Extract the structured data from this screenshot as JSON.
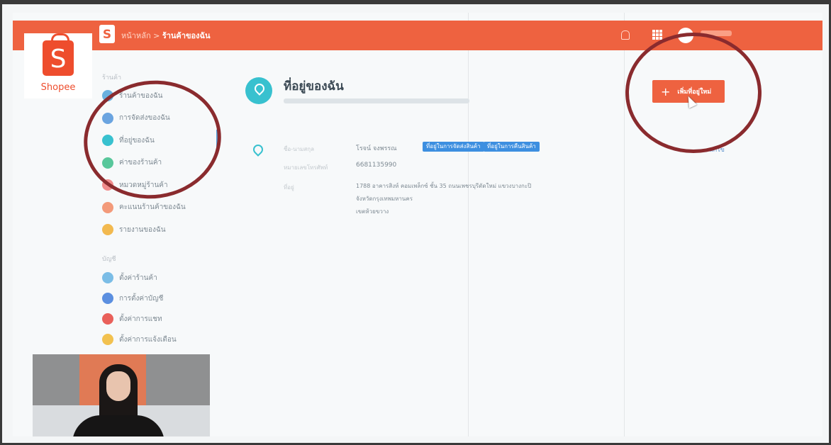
{
  "header": {
    "crumb_home": "หน้าหลัก > ",
    "crumb_current": "ร้านค้าของฉัน",
    "logo_letter": "S"
  },
  "logo": {
    "letter": "S",
    "word": "Shopee"
  },
  "sidebar": {
    "group1_label": "ร้านค้า",
    "items": [
      {
        "label": "ร้านค้าของฉัน",
        "color": "#6ab0de"
      },
      {
        "label": "การจัดส่งของฉัน",
        "color": "#6aa4e0"
      },
      {
        "label": "ที่อยู่ของฉัน",
        "color": "#38c1cf"
      },
      {
        "label": "ค่าของร้านค้า",
        "color": "#58c79b"
      },
      {
        "label": "หมวดหมู่ร้านค้า",
        "color": "#f08c8c"
      },
      {
        "label": "คะแนนร้านค้าของฉัน",
        "color": "#f39a7a"
      },
      {
        "label": "รายงานของฉัน",
        "color": "#f2b94f"
      }
    ],
    "group2_label": "บัญชี",
    "items2": [
      {
        "label": "ตั้งค่าร้านค้า",
        "color": "#7bbde6"
      },
      {
        "label": "การตั้งค่าบัญชี",
        "color": "#5b8fe0"
      },
      {
        "label": "ตั้งค่าการแชท",
        "color": "#e9605a"
      },
      {
        "label": "ตั้งค่าการแจ้งเตือน",
        "color": "#f2c14f"
      }
    ]
  },
  "main": {
    "title": "ที่อยู่ของฉัน",
    "add_button": "เพิ่มที่อยู่ใหม่",
    "edit_link": "แก้ไข",
    "address": {
      "name_label": "ชื่อ-นามสกุล",
      "name_value": "โรจน์ จงพรรณ",
      "tags": [
        "ที่อยู่ในการจัดส่งสินค้า",
        "ที่อยู่ในการคืนสินค้า"
      ],
      "phone_label": "หมายเลขโทรศัพท์",
      "phone_value": "6681135990",
      "addr_label": "ที่อยู่",
      "addr_line1": "1788 อาคารสิงห์ คอมเพล็กซ์ ชั้น 35 ถนนเพชรบุรีตัดใหม่ แขวงบางกะปิ",
      "addr_line2": "จังหวัดกรุงเทพมหานคร",
      "addr_line3": "เขตห้วยขวาง"
    }
  }
}
